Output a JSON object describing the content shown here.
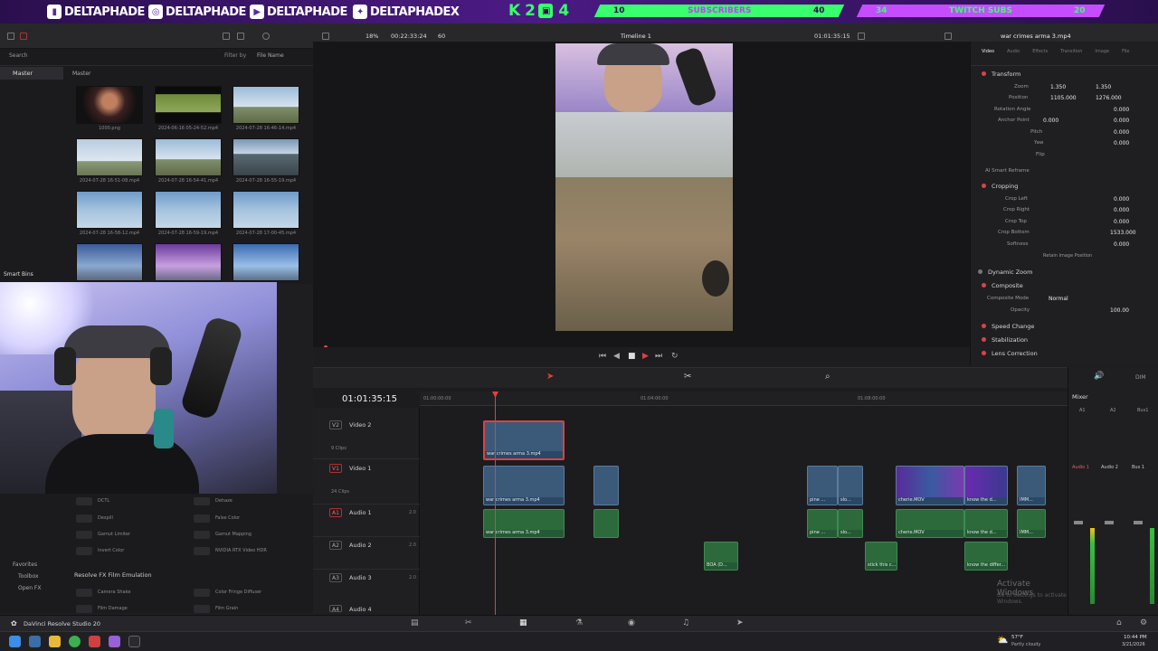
{
  "banner": {
    "handles": [
      "DELTAPHADE",
      "DELTAPHADE",
      "DELTAPHADE",
      "DELTAPHADEX"
    ],
    "k2": "K 2",
    "k2_number": "4",
    "goals": [
      {
        "start": "10",
        "label": "SUBSCRIBERS",
        "end": "40"
      },
      {
        "start": "34",
        "label": "TWITCH SUBS",
        "end": "20"
      }
    ]
  },
  "toolbar": {
    "zoom": "18%",
    "timecode_in": "00:22:33:24",
    "fps": "60",
    "timeline_title": "Timeline 1",
    "viewer_timecode": "01:01:35:15",
    "clip_name": "war crimes arma 3.mp4"
  },
  "media": {
    "search": "Search",
    "filter_label": "Filter by",
    "filter_value": "File Name",
    "master_left": "Master",
    "master_right": "Master",
    "smart_bins": "Smart Bins",
    "clips": [
      "1000.png",
      "2024-06-16 05-24-52.mp4",
      "2024-07-28 16-46-14.mp4",
      "2024-07-28 16-51-08.mp4",
      "2024-07-28 16-54-41.mp4",
      "2024-07-28 16-55-19.mp4",
      "2024-07-28 16-58-12.mp4",
      "2024-07-28 16-59-19.mp4",
      "2024-07-28 17-00-45.mp4"
    ]
  },
  "inspector": {
    "tabs": [
      "Video",
      "Audio",
      "Effects",
      "Transition",
      "Image",
      "File"
    ],
    "transform": "Transform",
    "zoom": {
      "label": "Zoom",
      "x": "1.350",
      "y": "1.350"
    },
    "position": {
      "label": "Position",
      "x": "1105.000",
      "y": "1276.000"
    },
    "rotation": {
      "label": "Rotation Angle",
      "value": "0.000"
    },
    "anchor": {
      "label": "Anchor Point",
      "x": "0.000",
      "y": "0.000"
    },
    "pitch": {
      "label": "Pitch",
      "value": "0.000"
    },
    "yaw": {
      "label": "Yaw",
      "value": "0.000"
    },
    "flip": "Flip",
    "smart_reframe": "AI Smart Reframe",
    "cropping": "Cropping",
    "crop_left": {
      "label": "Crop Left",
      "value": "0.000"
    },
    "crop_right": {
      "label": "Crop Right",
      "value": "0.000"
    },
    "crop_top": {
      "label": "Crop Top",
      "value": "0.000"
    },
    "crop_bottom": {
      "label": "Crop Bottom",
      "value": "1533.000"
    },
    "softness": {
      "label": "Softness",
      "value": "0.000"
    },
    "retain": "Retain Image Position",
    "dynamic_zoom": "Dynamic Zoom",
    "composite": "Composite",
    "composite_mode": {
      "label": "Composite Mode",
      "value": "Normal"
    },
    "opacity": {
      "label": "Opacity",
      "value": "100.00"
    },
    "speed_change": "Speed Change",
    "stabilization": "Stabilization",
    "lens_correction": "Lens Correction"
  },
  "timeline": {
    "timecode": "01:01:35:15",
    "ruler": [
      "01:00:00:00",
      "01:04:00:00",
      "01:08:00:00"
    ],
    "tracks": [
      {
        "id": "V2",
        "name": "Video 2",
        "sub": "9 Clips"
      },
      {
        "id": "V1",
        "name": "Video 1",
        "sub": "24 Clips"
      },
      {
        "id": "A1",
        "name": "Audio 1",
        "sub": "2.0"
      },
      {
        "id": "A2",
        "name": "Audio 2",
        "sub": "2.0"
      },
      {
        "id": "A3",
        "name": "Audio 3",
        "sub": "2.0"
      },
      {
        "id": "A4",
        "name": "Audio 4",
        "sub": ""
      }
    ],
    "clips": {
      "v2_main": "war crimes arma 3.mp4",
      "v1_main": "war crimes arma 3.mp4",
      "a1_main": "war crimes arma 3.mp4",
      "v1_pine": "pine ...",
      "v1_slo": "slo...",
      "v1_cherie": "cherie.MOV",
      "v1_know": "know the d...",
      "v1_imm": "IMM...",
      "a1_pine": "pine ...",
      "a1_slo": "slo...",
      "a1_cherie": "cherie.MOV",
      "a1_know": "know the d...",
      "a1_imm": "IMM...",
      "a2_boa": "BOA (D...",
      "a2_stick": "stick this c...",
      "a2_know": "know the differ..."
    }
  },
  "effects": {
    "items_left": [
      "DCTL",
      "Despill",
      "Gamut Limiter",
      "Invert Color"
    ],
    "items_right": [
      "Dehaze",
      "False Color",
      "Gamut Mapping",
      "NVIDIA RTX Video HDR"
    ],
    "favorites": "Favorites",
    "toolbox": "Toolbox",
    "open_fx": "Open FX",
    "category": "Resolve FX Film Emulation",
    "film_left": [
      "Camera Shake",
      "Film Damage"
    ],
    "film_right": [
      "Color Fringe Diffuser",
      "Film Grain"
    ]
  },
  "mixer": {
    "title": "Mixer",
    "channels": [
      "A1",
      "A2",
      "Bus1"
    ],
    "channel_labels": [
      "Audio 1",
      "Audio 2",
      "Bus 1"
    ],
    "dim": "DIM"
  },
  "watermark": {
    "title": "Activate Windows",
    "sub": "Go to Settings to activate Windows."
  },
  "footer": {
    "app_name": "DaVinci Resolve Studio 20"
  },
  "taskbar": {
    "weather_temp": "57°F",
    "weather_desc": "Partly cloudy",
    "time": "10:44 PM",
    "date": "3/21/2026"
  }
}
